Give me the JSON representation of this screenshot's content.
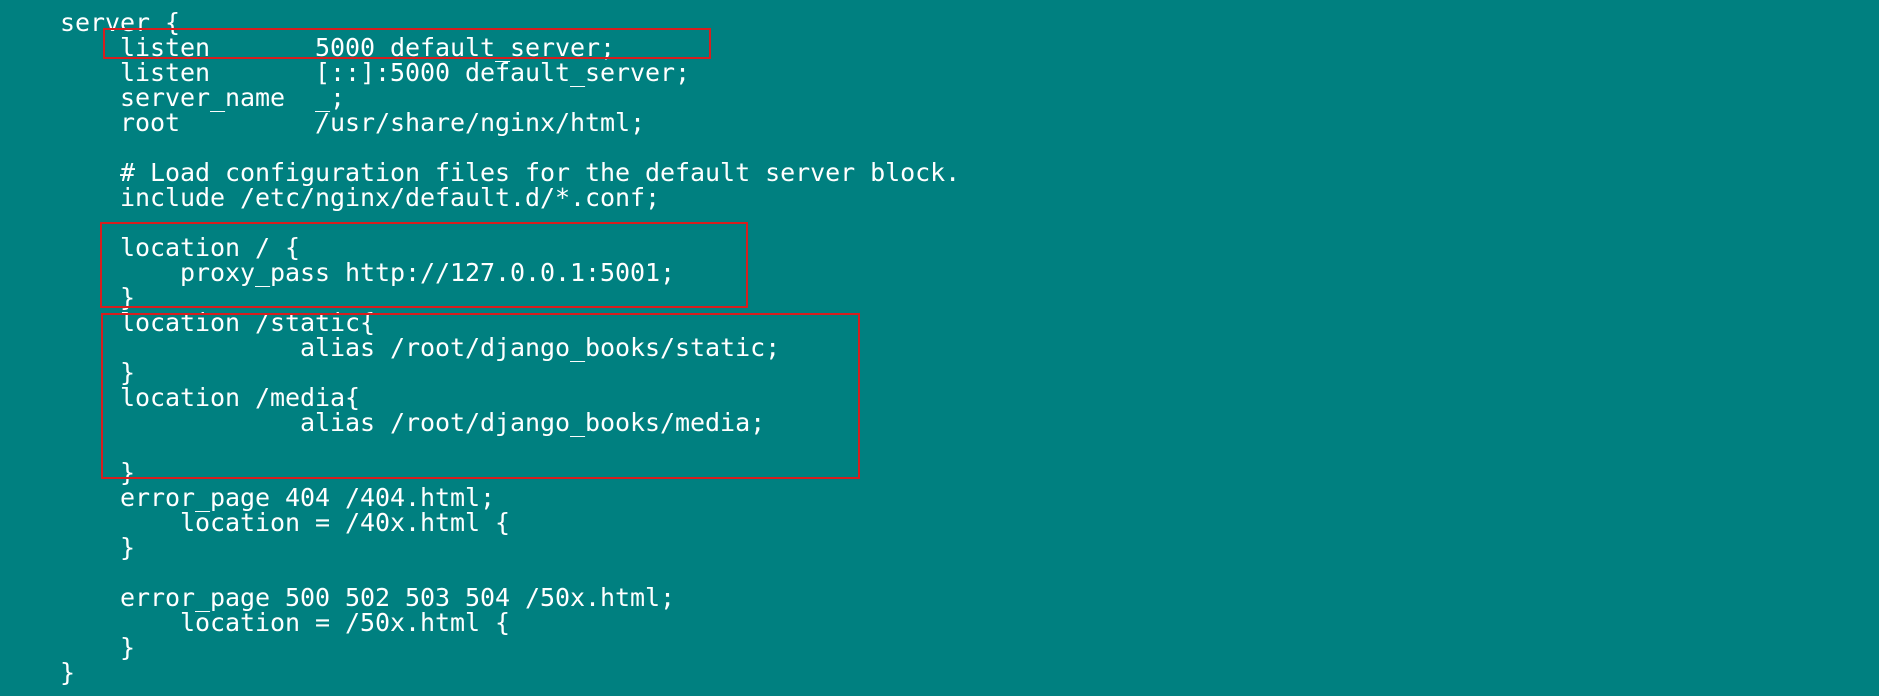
{
  "terminal": {
    "background_color": "#008080",
    "text_color": "#ffffff",
    "highlight_color": "#d81e1e",
    "lines": [
      "    server {",
      "        listen       5000 default_server;",
      "        listen       [::]:5000 default_server;",
      "        server_name  _;",
      "        root         /usr/share/nginx/html;",
      "",
      "        # Load configuration files for the default server block.",
      "        include /etc/nginx/default.d/*.conf;",
      "",
      "        location / {",
      "            proxy_pass http://127.0.0.1:5001;",
      "        }",
      "        location /static{",
      "                    alias /root/django_books/static;",
      "        }",
      "        location /media{",
      "                    alias /root/django_books/media;",
      "",
      "        }",
      "        error_page 404 /404.html;",
      "            location = /40x.html {",
      "        }",
      "",
      "        error_page 500 502 503 504 /50x.html;",
      "            location = /50x.html {",
      "        }",
      "    }"
    ]
  }
}
